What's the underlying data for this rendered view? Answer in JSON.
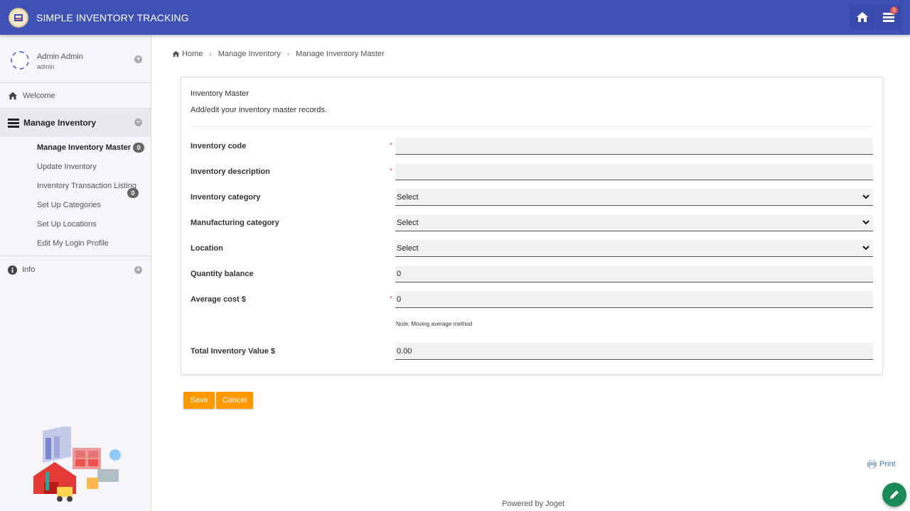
{
  "header": {
    "app_title": "SIMPLE INVENTORY TRACKING",
    "home_icon": "home-icon",
    "notifications_icon": "inbox-icon",
    "notification_count": "0"
  },
  "sidebar": {
    "profile": {
      "name": "Admin Admin",
      "username": "admin"
    },
    "welcome_label": "Welcome",
    "manage_label": "Manage Inventory",
    "items": [
      {
        "label": "Manage Inventory Master",
        "count": "0"
      },
      {
        "label": "Update Inventory"
      },
      {
        "label": "Inventory Transaction Listing",
        "count": "0"
      },
      {
        "label": "Set Up Categories"
      },
      {
        "label": "Set Up Locations"
      },
      {
        "label": "Edit My Login Profile"
      }
    ],
    "info_label": "Info"
  },
  "breadcrumb": [
    "Home",
    "Manage Inventory",
    "Manage Inventory Master"
  ],
  "form": {
    "title": "Inventory Master",
    "description": "Add/edit your inventory master records.",
    "fields": {
      "inventory_code": {
        "label": "Inventory code",
        "value": ""
      },
      "inventory_description": {
        "label": "Inventory description",
        "value": ""
      },
      "inventory_category": {
        "label": "Inventory category",
        "value": "Select"
      },
      "manufacturing_category": {
        "label": "Manufacturing category",
        "value": "Select"
      },
      "location": {
        "label": "Location",
        "value": "Select"
      },
      "quantity_balance": {
        "label": "Quantity balance",
        "value": "0"
      },
      "average_cost": {
        "label": "Average cost $",
        "value": "0",
        "note": "Note: Moving average method"
      },
      "total_value": {
        "label": "Total Inventory Value $",
        "value": "0.00"
      }
    },
    "required_mark": "*"
  },
  "buttons": {
    "save": "Save",
    "cancel": "Cancel"
  },
  "print_label": "Print",
  "footer": "Powered by Joget",
  "colors": {
    "header": "#3f51b5",
    "accent": "#ff9800",
    "fab": "#1b8a5a",
    "required": "#d9534f"
  }
}
